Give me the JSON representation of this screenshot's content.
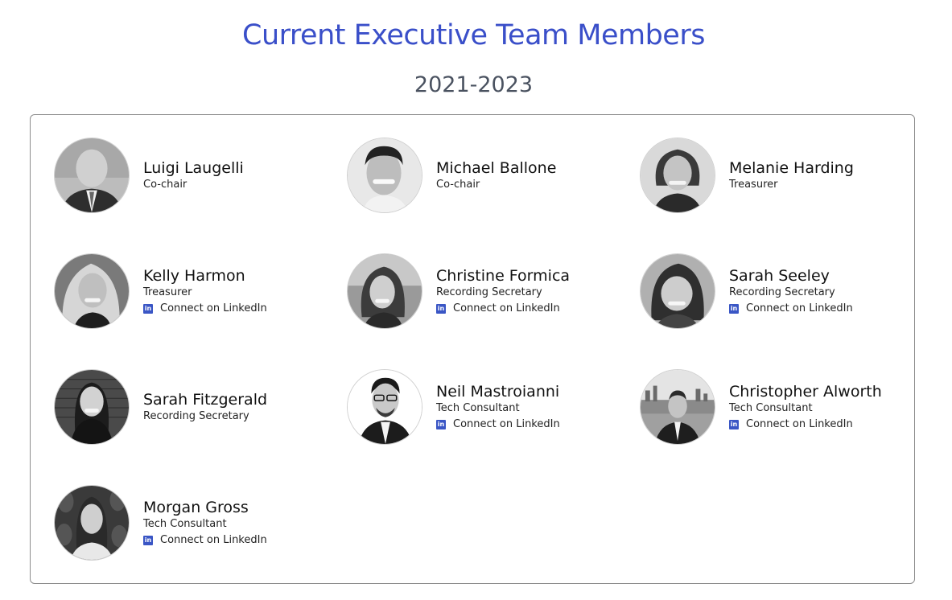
{
  "header": {
    "title": "Current Executive Team Members",
    "subtitle": "2021-2023"
  },
  "colors": {
    "title": "#3a4fc9",
    "subtitle": "#4a5260",
    "linkedin": "#3a56c5",
    "card_border": "#8c8c8c"
  },
  "members": [
    {
      "name": "Luigi Laugelli",
      "role": "Co-chair",
      "linkedin_label": ""
    },
    {
      "name": "Michael Ballone",
      "role": "Co-chair",
      "linkedin_label": ""
    },
    {
      "name": "Melanie Harding",
      "role": "Treasurer",
      "linkedin_label": ""
    },
    {
      "name": "Kelly Harmon",
      "role": "Treasurer",
      "linkedin_label": "Connect on LinkedIn"
    },
    {
      "name": "Christine Formica",
      "role": "Recording Secretary",
      "linkedin_label": "Connect on LinkedIn"
    },
    {
      "name": "Sarah Seeley",
      "role": "Recording Secretary",
      "linkedin_label": "Connect on LinkedIn"
    },
    {
      "name": "Sarah Fitzgerald",
      "role": "Recording Secretary",
      "linkedin_label": ""
    },
    {
      "name": "Neil Mastroianni",
      "role": "Tech Consultant",
      "linkedin_label": "Connect on LinkedIn"
    },
    {
      "name": "Christopher Alworth",
      "role": "Tech Consultant",
      "linkedin_label": "Connect on LinkedIn"
    },
    {
      "name": "Morgan Gross",
      "role": "Tech Consultant",
      "linkedin_label": "Connect on LinkedIn"
    }
  ],
  "icons": {
    "linkedin": "linkedin-icon",
    "avatar": "profile-photo"
  }
}
